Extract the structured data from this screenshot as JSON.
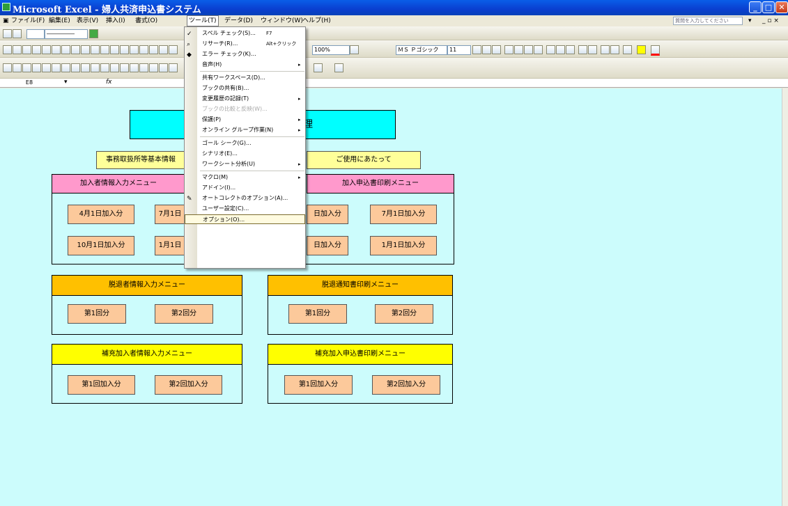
{
  "window": {
    "title": "Microsoft Excel - 婦人共済申込書システム"
  },
  "menubar": {
    "items": [
      "ファイル(F)",
      "編集(E)",
      "表示(V)",
      "挿入(I)",
      "書式(O)",
      "ツール(T)",
      "データ(D)",
      "ウィンドウ(W)",
      "ヘルプ(H)"
    ],
    "help_placeholder": "質問を入力してください"
  },
  "toolbar": {
    "zoom": "100%",
    "font": "ＭＳ Ｐゴシック",
    "size": "11"
  },
  "formula_bar": {
    "cell_ref": "E8",
    "fx": "fx"
  },
  "tools_menu": [
    {
      "label": "スペル チェック(S)...",
      "shortcut": "F7",
      "icon": "spell-check-icon"
    },
    {
      "label": "リサーチ(R)...",
      "shortcut": "Alt+クリック",
      "icon": "research-icon"
    },
    {
      "label": "エラー チェック(K)...",
      "icon": "error-check-icon"
    },
    {
      "label": "音声(H)",
      "arrow": "▸"
    },
    {
      "label": "共有ワークスペース(D)..."
    },
    {
      "label": "ブックの共有(B)..."
    },
    {
      "label": "変更履歴の記録(T)",
      "arrow": "▸"
    },
    {
      "label": "ブックの比較と反映(W)...",
      "disabled": true
    },
    {
      "label": "保護(P)",
      "arrow": "▸"
    },
    {
      "label": "オンライン グループ作業(N)",
      "arrow": "▸"
    },
    {
      "label": "ゴール シーク(G)..."
    },
    {
      "label": "シナリオ(E)..."
    },
    {
      "label": "ワークシート分析(U)",
      "arrow": "▸"
    },
    {
      "label": "マクロ(M)",
      "arrow": "▸"
    },
    {
      "label": "アドイン(I)..."
    },
    {
      "label": "オートコレクトのオプション(A)...",
      "icon": "autocorrect-icon"
    },
    {
      "label": "ユーザー設定(C)..."
    },
    {
      "label": "オプション(O)...",
      "highlighted": true
    }
  ],
  "sheet": {
    "title_box": "理",
    "office_info": "事務取扱所等基本情報",
    "usage_note": "ご使用にあたって",
    "join_input_menu": "加入者情報入力メニュー",
    "join_print_menu": "加入申込書印刷メニュー",
    "btn_apr": "4月1日加入分",
    "btn_jul": "7月1日",
    "btn_oct": "10月1日加入分",
    "btn_jan": "1月1日",
    "btn_apr_print": "日加入分",
    "btn_jul_print": "7月1日加入分",
    "btn_oct_print": "日加入分",
    "btn_jan_print": "1月1日加入分",
    "withdraw_input_menu": "脱退者情報入力メニュー",
    "withdraw_print_menu": "脱退通知書印刷メニュー",
    "round1": "第1回分",
    "round2": "第2回分",
    "supp_input_menu": "補充加入者情報入力メニュー",
    "supp_print_menu": "補充加入申込書印刷メニュー",
    "supp_round1": "第1回加入分",
    "supp_round2": "第2回加入分"
  }
}
